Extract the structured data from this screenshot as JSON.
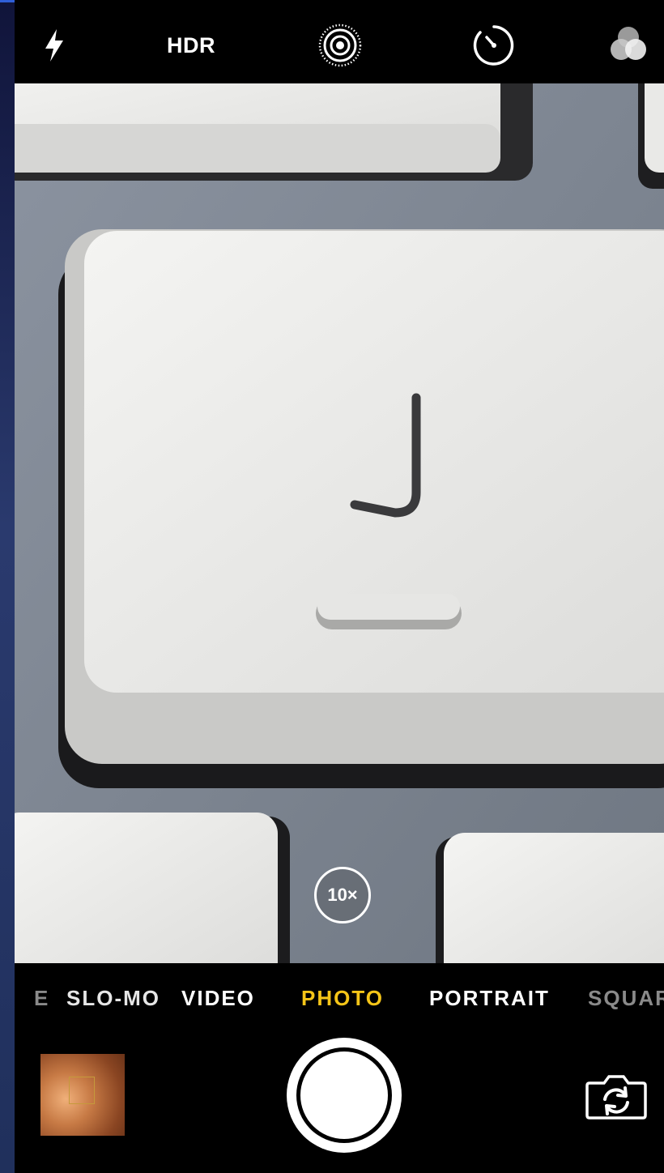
{
  "top_bar": {
    "flash_icon": "flash-icon",
    "hdr_label": "HDR",
    "live_photo_icon": "live-photo-icon",
    "timer_icon": "timer-icon",
    "filters_icon": "filters-icon"
  },
  "viewfinder": {
    "zoom_label": "10×"
  },
  "modes": [
    {
      "label": "E"
    },
    {
      "label": "SLO-MO"
    },
    {
      "label": "VIDEO"
    },
    {
      "label": "PHOTO"
    },
    {
      "label": "PORTRAIT"
    },
    {
      "label": "SQUARE"
    }
  ],
  "active_mode": "PHOTO",
  "controls": {
    "thumbnail": "last-photo-thumbnail",
    "shutter": "shutter-button",
    "switch_camera_icon": "switch-camera-icon"
  },
  "colors": {
    "active_mode": "#f5c518",
    "background": "#000000"
  }
}
